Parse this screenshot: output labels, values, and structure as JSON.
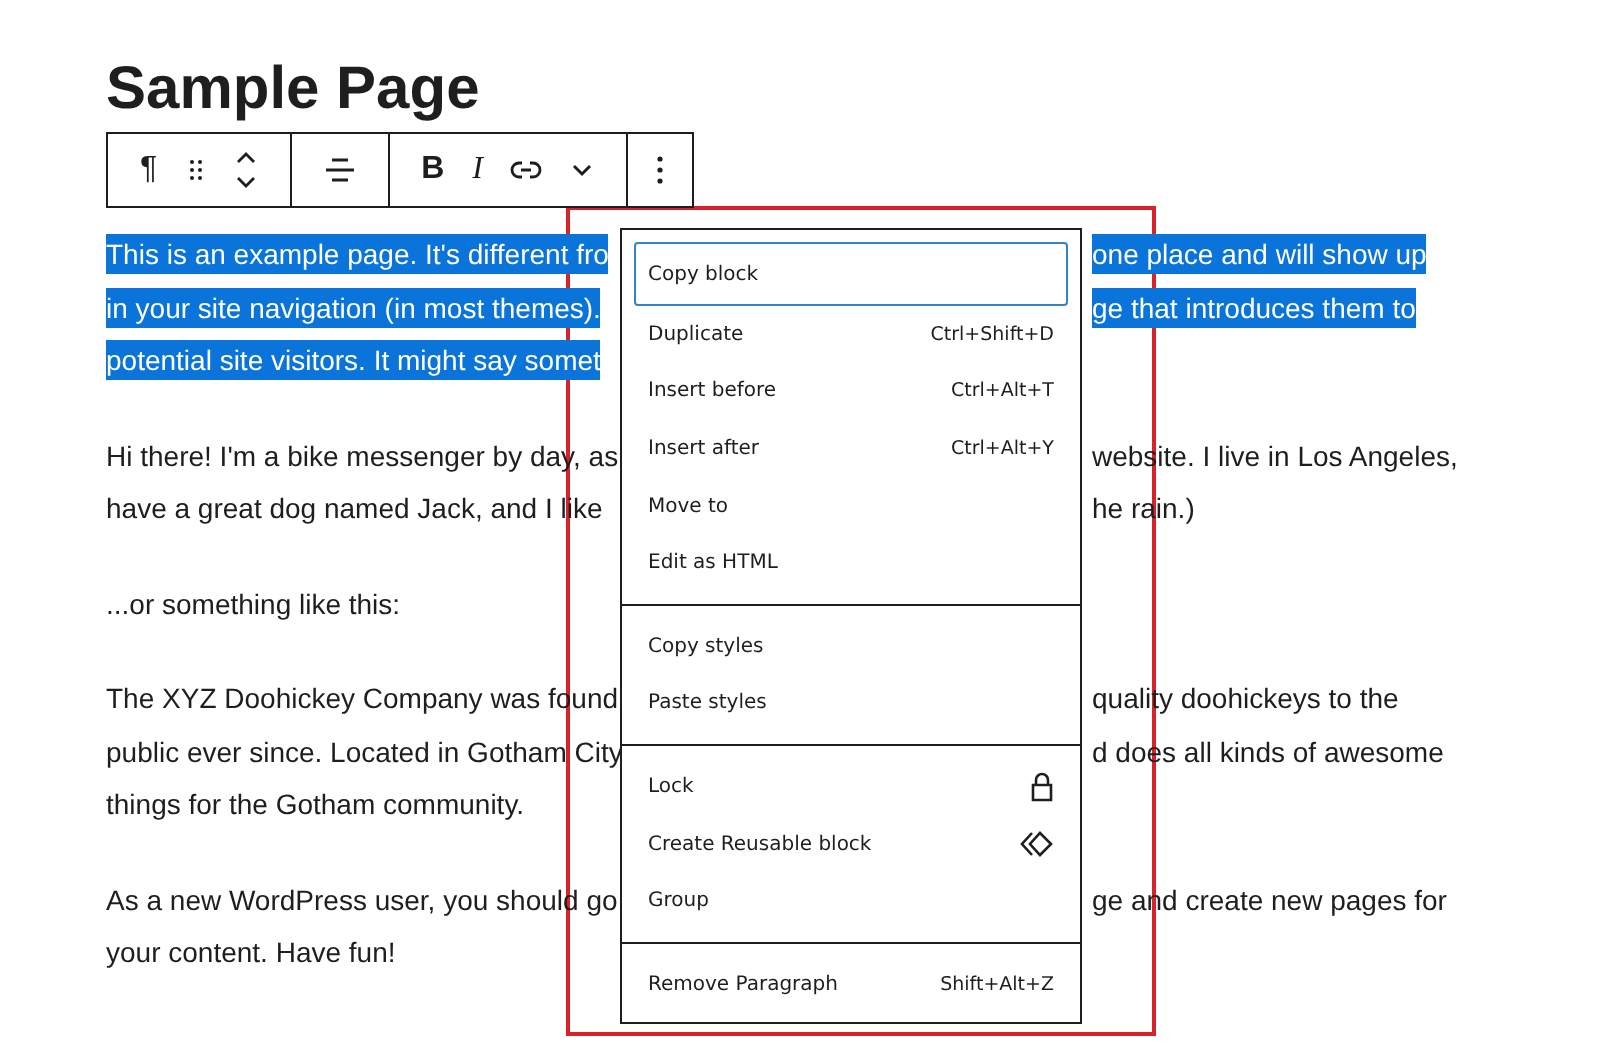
{
  "title": "Sample Page",
  "toolbar": {
    "paragraph_glyph": "¶",
    "bold": "B",
    "italic": "I"
  },
  "paragraphs": [
    {
      "selected": true,
      "lines": [
        {
          "left": "This is an example page. It's different fro",
          "right": "one place and will show up"
        },
        {
          "left": "in your site navigation (in most themes).",
          "right": "ge that introduces them to"
        },
        {
          "left": "potential site visitors. It might say somet"
        }
      ]
    },
    {
      "selected": false,
      "lines": [
        {
          "left": "Hi there! I'm a bike messenger by day, as",
          "right": "website. I live in Los Angeles,"
        },
        {
          "left": "have a great dog named Jack, and I like",
          "right": "he rain.)"
        }
      ]
    },
    {
      "selected": false,
      "lines": [
        {
          "left": "...or something like this:"
        }
      ]
    },
    {
      "selected": false,
      "lines": [
        {
          "left": "The XYZ Doohickey Company was found",
          "right": "quality doohickeys to the"
        },
        {
          "left": "public ever since. Located in Gotham City",
          "right": "d does all kinds of awesome"
        },
        {
          "left": "things for the Gotham community."
        }
      ]
    },
    {
      "selected": false,
      "lines": [
        {
          "left": "As a new WordPress user, you should go",
          "right": "ge and create new pages for"
        },
        {
          "left": "your content. Have fun!"
        }
      ]
    }
  ],
  "menu": {
    "groups": [
      [
        {
          "label": "Copy block",
          "selected": true
        },
        {
          "label": "Duplicate",
          "shortcut": "Ctrl+Shift+D",
          "selected": false
        },
        {
          "label": "Insert before",
          "shortcut": "Ctrl+Alt+T",
          "selected": false
        },
        {
          "label": "Insert after",
          "shortcut": "Ctrl+Alt+Y",
          "selected": false
        },
        {
          "label": "Move to",
          "selected": false
        },
        {
          "label": "Edit as HTML",
          "selected": false
        }
      ],
      [
        {
          "label": "Copy styles",
          "selected": false
        },
        {
          "label": "Paste styles",
          "selected": false
        }
      ],
      [
        {
          "label": "Lock",
          "kind": "lock",
          "selected": false
        },
        {
          "label": "Create Reusable block",
          "kind": "reusable",
          "selected": false
        },
        {
          "label": "Group",
          "selected": false
        }
      ],
      [
        {
          "label": "Remove Paragraph",
          "shortcut": "Shift+Alt+Z",
          "selected": false
        }
      ]
    ]
  }
}
